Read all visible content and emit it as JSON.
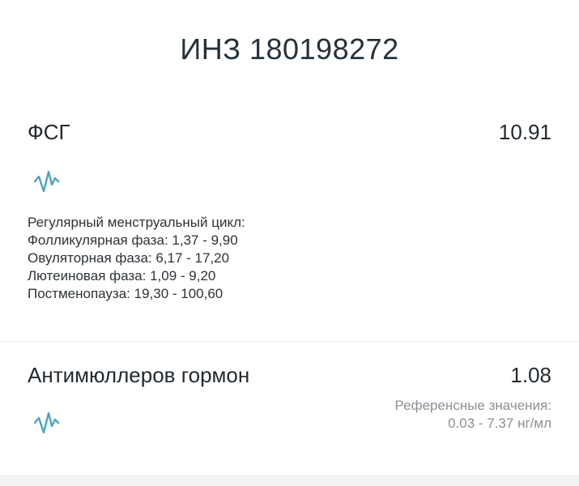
{
  "header": {
    "title": "ИНЗ 180198272"
  },
  "results": [
    {
      "name": "ФСГ",
      "value": "10.91",
      "trend_icon": "trend-chart-icon",
      "reference_lines": [
        "Регулярный менструальный цикл:",
        "Фолликулярная фаза: 1,37 - 9,90",
        "Овуляторная фаза: 6,17 - 17,20",
        "Лютеиновая фаза: 1,09 - 9,20",
        "Постменопауза: 19,30 - 100,60"
      ]
    },
    {
      "name": "Антимюллеров гормон",
      "value": "1.08",
      "trend_icon": "trend-chart-icon",
      "reference_lines": [
        "Референсные значения:",
        "0.03 - 7.37 нг/мл"
      ]
    }
  ],
  "colors": {
    "text_primary": "#222a30",
    "text_secondary": "#8b9096",
    "icon_accent": "#4aa6bf",
    "divider": "#ececec",
    "background": "#ffffff"
  }
}
